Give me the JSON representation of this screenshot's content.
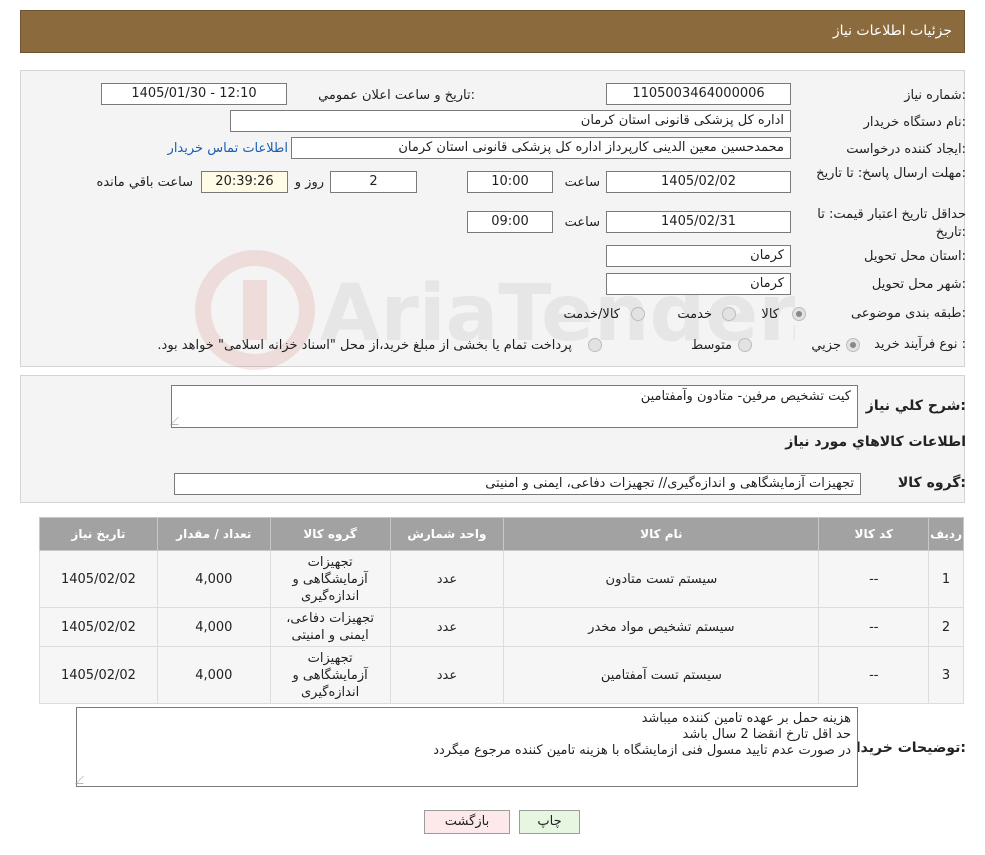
{
  "header": {
    "title": "جزئیات اطلاعات نیاز"
  },
  "watermark": {
    "text": "AriaTender.neT"
  },
  "info": {
    "need_number_label": "شماره نیاز:",
    "need_number": "1105003464000006",
    "announce_label": "تاریخ و ساعت اعلان عمومي:",
    "announce_value": "1405/01/30 - 12:10",
    "buyer_org_label": "نام دستگاه خريدار:",
    "buyer_org": "اداره کل پزشکی قانونی استان کرمان",
    "creator_label": "ایجاد کننده درخواست:",
    "creator": "محمدحسین معین الدینی کارپرداز اداره کل پزشکی قانونی استان کرمان",
    "contact_link": "اطلاعات تماس خریدار",
    "deadline_label": "مهلت ارسال پاسخ: تا تاریخ:",
    "deadline_date": "1405/02/02",
    "time_label": "ساعت",
    "deadline_time": "10:00",
    "days_value": "2",
    "days_label": "روز و",
    "remaining_time": "20:39:26",
    "remaining_label": "ساعت باقي مانده",
    "validity_label": "حداقل تاريخ اعتبار قيمت: تا تاريخ:",
    "validity_date": "1405/02/31",
    "validity_time": "09:00",
    "province_label": "استان محل تحويل:",
    "province": "کرمان",
    "city_label": "شهر محل تحويل:",
    "city": "کرمان",
    "category_label": "طبقه بندی موضوعی:",
    "category_options": [
      "کالا",
      "خدمت",
      "کالا/خدمت"
    ],
    "process_label": "نوع فرآيند خريد :",
    "process_options": [
      "جزيي",
      "متوسط"
    ],
    "process_note": "پرداخت تمام یا بخشی از مبلغ خرید،از محل \"اسناد خزانه اسلامی\" خواهد بود."
  },
  "summary": {
    "label": "شرح کلي نياز:",
    "text": "کیت تشخیص مرفین- متادون وآمفتامین",
    "goods_info_title": "اطلاعات کالاهاي مورد نياز",
    "group_label": "گروه کالا:",
    "group_value": "تجهیزات آزمایشگاهی و اندازه‌گیری// تجهیزات دفاعی، ایمنی و امنیتی"
  },
  "table": {
    "headers": [
      "رديف",
      "کد کالا",
      "نام کالا",
      "واحد شمارش",
      "گروه کالا",
      "تعداد / مقدار",
      "تاريخ نياز"
    ],
    "rows": [
      {
        "row": "1",
        "code": "--",
        "name": "سیستم تست متادون",
        "unit": "عدد",
        "group": "تجهیزات آزمایشگاهی و اندازه‌گیری",
        "qty": "4,000",
        "date": "1405/02/02"
      },
      {
        "row": "2",
        "code": "--",
        "name": "سیستم تشخیص مواد مخدر",
        "unit": "عدد",
        "group": "تجهیزات دفاعی، ایمنی و امنیتی",
        "qty": "4,000",
        "date": "1405/02/02"
      },
      {
        "row": "3",
        "code": "--",
        "name": "سیستم تست آمفتامین",
        "unit": "عدد",
        "group": "تجهیزات آزمایشگاهی و اندازه‌گیری",
        "qty": "4,000",
        "date": "1405/02/02"
      }
    ]
  },
  "buyer_notes": {
    "label": "توضیحات خریدار:",
    "lines": [
      "هزینه حمل بر عهده تامین کننده میباشد",
      "حد اقل تارخ انقضا 2 سال باشد",
      "در صورت عدم تایید مسول فنی ازمایشگاه با هزینه تامین کننده مرجوع میگردد"
    ]
  },
  "buttons": {
    "print": "چاپ",
    "back": "بازگشت"
  },
  "colors": {
    "header_bg": "#8b6a3e",
    "table_header_bg": "#a2a2a2",
    "print_btn_bg": "#e6f6e0",
    "back_btn_bg": "#fde8ea"
  }
}
